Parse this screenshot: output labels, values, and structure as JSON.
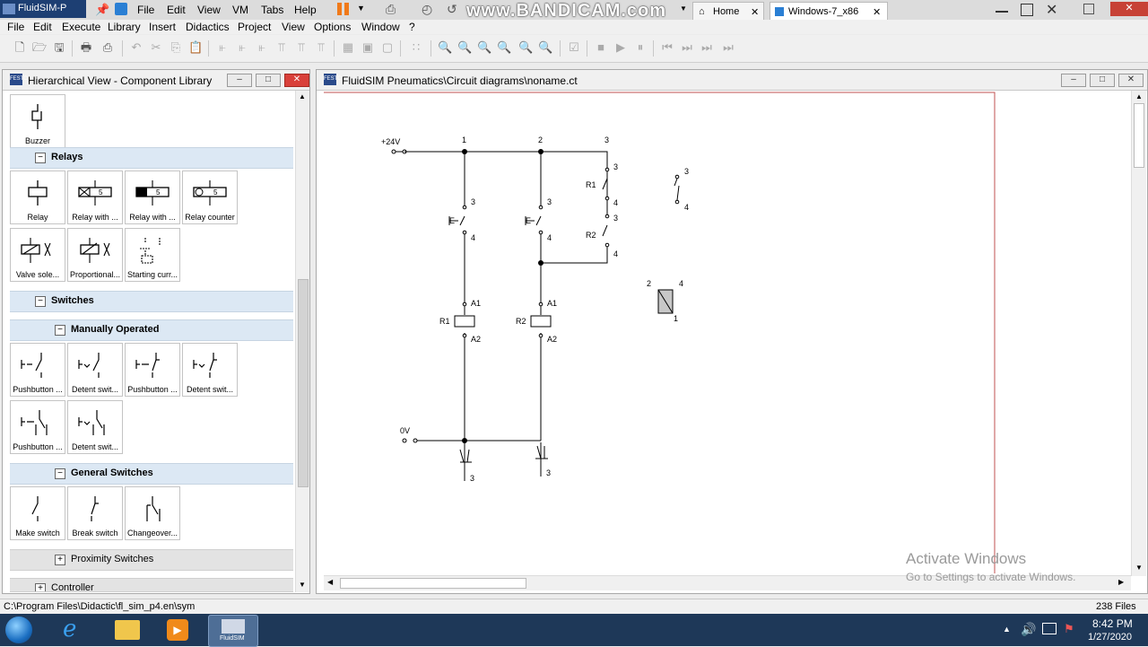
{
  "vm": {
    "app_title": "FluidSIM-P",
    "menu": [
      "File",
      "Edit",
      "View",
      "VM",
      "Tabs",
      "Help"
    ],
    "watermark": "www.BANDICAM.com",
    "tabs": [
      {
        "label": "Home"
      },
      {
        "label": "Windows-7_x86"
      }
    ]
  },
  "menubar": [
    "File",
    "Edit",
    "Execute",
    "Library",
    "Insert",
    "Didactics",
    "Project",
    "View",
    "Options",
    "Window",
    "?"
  ],
  "library": {
    "title": "Hierarchical View - Component Library",
    "top_tile": "Buzzer",
    "sections": {
      "relays": "Relays",
      "switches": "Switches",
      "manually": "Manually Operated",
      "general": "General Switches",
      "proximity": "Proximity Switches",
      "controller": "Controller"
    },
    "relay_tiles": [
      "Relay",
      "Relay with ...",
      "Relay with ...",
      "Relay counter",
      "Valve sole...",
      "Proportional...",
      "Starting curr..."
    ],
    "manual_tiles": [
      "Pushbutton ...",
      "Detent swit...",
      "Pushbutton ...",
      "Detent swit...",
      "Pushbutton ...",
      "Detent swit..."
    ],
    "general_tiles": [
      "Make switch",
      "Break switch",
      "Changeover..."
    ]
  },
  "circuit": {
    "title": "FluidSIM Pneumatics\\Circuit diagrams\\noname.ct",
    "labels": {
      "v24": "+24V",
      "v0": "0V",
      "c1": "1",
      "c2": "2",
      "c3": "3",
      "r1": "R1",
      "r2": "R2",
      "a1": "A1",
      "a2": "A2",
      "n3": "3",
      "n4": "4",
      "n1": "1",
      "n2": "2"
    }
  },
  "activate": {
    "line1": "Activate Windows",
    "line2": "Go to Settings to activate Windows."
  },
  "status": {
    "path": "C:\\Program Files\\Didactic\\fl_sim_p4.en\\sym",
    "files": "238 Files"
  },
  "taskbar": {
    "fluidsim": "FluidSIM",
    "time": "8:42 PM",
    "date": "1/27/2020"
  }
}
